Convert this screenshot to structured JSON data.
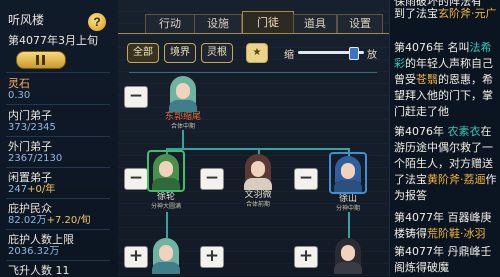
{
  "left": {
    "sect_name": "听风楼",
    "date": "第4077年3月上旬",
    "stone_label": "灵石",
    "stone_value": "0.30",
    "inner_label": "内门弟子",
    "inner_value": "373/2345",
    "outer_label": "外门弟子",
    "outer_value": "2367/2130",
    "idle_label": "闲置弟子",
    "idle_value": "247",
    "idle_delta": "+0/年",
    "protect_label": "庇护民众",
    "protect_value": "82.02万",
    "protect_delta": "+7.20/旬",
    "limit_label": "庇护人数上限",
    "limit_value": "2036.32万",
    "flying_label": "飞升人数",
    "flying_value": "11"
  },
  "tabs": [
    "行动",
    "设施",
    "门徒",
    "道具",
    "设置"
  ],
  "active_tab": "门徒",
  "filters": {
    "all": "全部",
    "realm": "境界",
    "root": "灵根",
    "star": "★"
  },
  "zoom": {
    "left_label": "缩",
    "right_label": "放",
    "level": 0.88
  },
  "nodes": {
    "top": {
      "name": "东郭缩尾",
      "title": "合体中期"
    },
    "left": {
      "name": "徐轮",
      "title": "分神大圆满"
    },
    "middle": {
      "name": "文羽微",
      "title": "合体前期"
    },
    "right": {
      "name": "徐山",
      "title": "分神中期"
    }
  },
  "log": [
    {
      "id": "l0",
      "parts": [
        [
          "t",
          "保雨破坏的阵法有"
        ]
      ]
    },
    {
      "id": "l1",
      "parts": [
        [
          "t",
          "到了法宝"
        ],
        [
          "o",
          "玄阶斧·元广"
        ]
      ]
    },
    {
      "id": "l2",
      "parts": [
        [
          "t",
          "第4076年 名叫"
        ],
        [
          "g",
          "法希彩"
        ],
        [
          "t",
          "的年轻人声称自己曾受"
        ],
        [
          "o",
          "苍翳"
        ],
        [
          "t",
          "的恩惠，希望拜入他的门下，掌门赶走了他"
        ]
      ]
    },
    {
      "id": "l3",
      "parts": [
        [
          "t",
          "第4076年 "
        ],
        [
          "g",
          "农素衣"
        ],
        [
          "t",
          "在游历途中偶尔救了一个陌生人，对方赠送了法宝"
        ],
        [
          "o",
          "黄阶斧·荔逦"
        ],
        [
          "t",
          "作为报答"
        ]
      ]
    },
    {
      "id": "l4",
      "parts": [
        [
          "t",
          "第4077年 百器峰庚楼铸得"
        ],
        [
          "o",
          "荒阶鞋·冰羽"
        ]
      ]
    },
    {
      "id": "l5",
      "parts": [
        [
          "t",
          "第4077年 丹鼎峰壬阁炼得破魔"
        ]
      ]
    }
  ],
  "colors": {
    "accent": "#a98b48",
    "tree_line": "#35a3a0",
    "name": "#e56d3f"
  }
}
